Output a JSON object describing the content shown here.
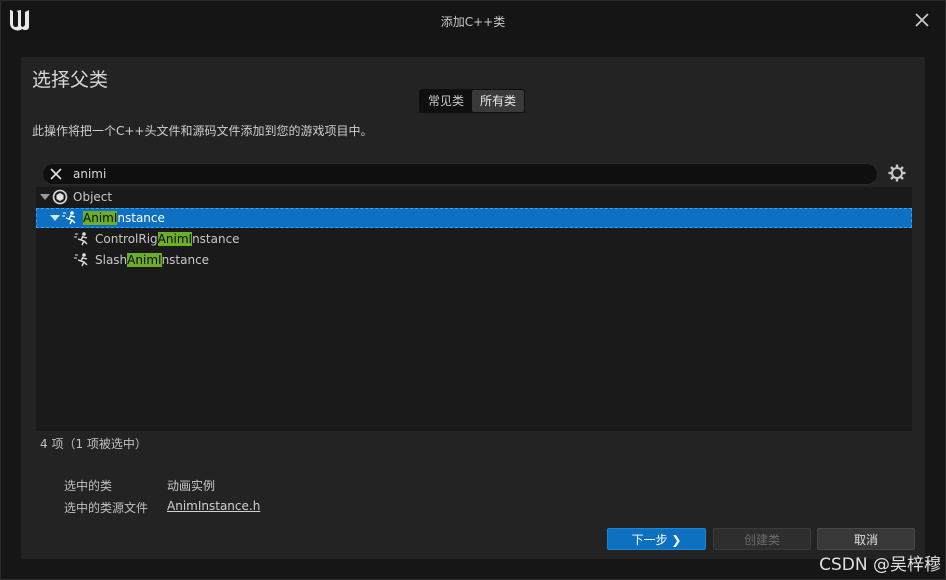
{
  "window": {
    "title": "添加C++类"
  },
  "panel": {
    "heading": "选择父类",
    "tabs": [
      {
        "label": "常见类",
        "active": false
      },
      {
        "label": "所有类",
        "active": true
      }
    ],
    "description": "此操作将把一个C++头文件和源码文件添加到您的游戏项目中。"
  },
  "search": {
    "value": "animi"
  },
  "tree": {
    "root": {
      "label": "Object"
    },
    "items": [
      {
        "prefix": "",
        "match": "AnimI",
        "suffix": "nstance",
        "selected": true
      },
      {
        "prefix": "ControlRig",
        "match": "AnimI",
        "suffix": "nstance",
        "selected": false
      },
      {
        "prefix": "Slash",
        "match": "AnimI",
        "suffix": "nstance",
        "selected": false
      }
    ]
  },
  "status": {
    "count_text": "4 项（1 项被选中）"
  },
  "details": {
    "selected_class_label": "选中的类",
    "selected_class_value": "动画实例",
    "source_file_label": "选中的类源文件",
    "source_file_value": "AnimInstance.h"
  },
  "buttons": {
    "next": "下一步 ❯",
    "create": "创建类",
    "cancel": "取消"
  },
  "watermark": "CSDN @吴梓穆",
  "colors": {
    "accent": "#0e70c0",
    "highlight": "#6cae27"
  }
}
